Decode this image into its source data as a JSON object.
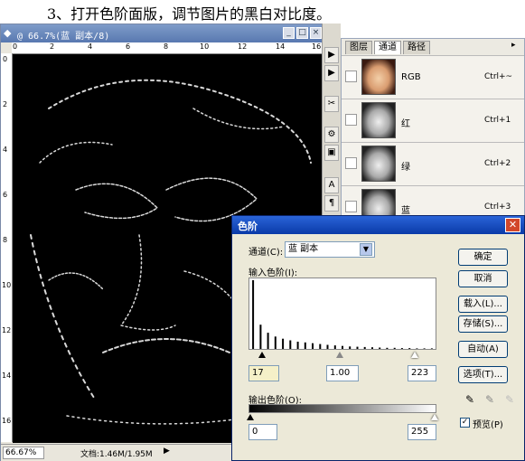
{
  "heading": "3、打开色阶面版，调节图片的黑白对比度。",
  "document": {
    "title": "@ 66.7%(蓝 副本/8)",
    "zoom": "66.67%",
    "info": "文档:1.46M/1.95M",
    "ruler_top": [
      "0",
      "2",
      "4",
      "6",
      "8",
      "10",
      "12",
      "14",
      "16"
    ],
    "ruler_left": [
      "0",
      "2",
      "4",
      "6",
      "8",
      "10",
      "12",
      "14",
      "16"
    ]
  },
  "tools": [
    "▶",
    "▶",
    "✂",
    "⚙",
    "▣",
    "A",
    "¶"
  ],
  "panel": {
    "tabs": [
      "图层",
      "通道",
      "路径"
    ],
    "active_tab": 1,
    "channels": [
      {
        "name": "RGB",
        "key": "Ctrl+~"
      },
      {
        "name": "红",
        "key": "Ctrl+1"
      },
      {
        "name": "绿",
        "key": "Ctrl+2"
      },
      {
        "name": "蓝",
        "key": "Ctrl+3"
      }
    ]
  },
  "levels": {
    "title": "色阶",
    "channel_label": "通道(C):",
    "channel_value": "蓝 副本",
    "input_label": "输入色阶(I):",
    "input_black": "17",
    "input_gamma": "1.00",
    "input_white": "223",
    "output_label": "输出色阶(O):",
    "output_black": "0",
    "output_white": "255",
    "buttons": [
      "确定",
      "取消",
      "载入(L)...",
      "存储(S)...",
      "自动(A)",
      "选项(T)..."
    ],
    "preview_label": "预览(P)",
    "preview_checked": true,
    "histogram": [
      255,
      90,
      60,
      46,
      38,
      32,
      27,
      24,
      21,
      18,
      15,
      13,
      11,
      9,
      8,
      7,
      6,
      5,
      4,
      4,
      3,
      3,
      2,
      2,
      2
    ]
  },
  "colors": {
    "title_blue": "#0a3aa8",
    "accent": "#003c74"
  }
}
